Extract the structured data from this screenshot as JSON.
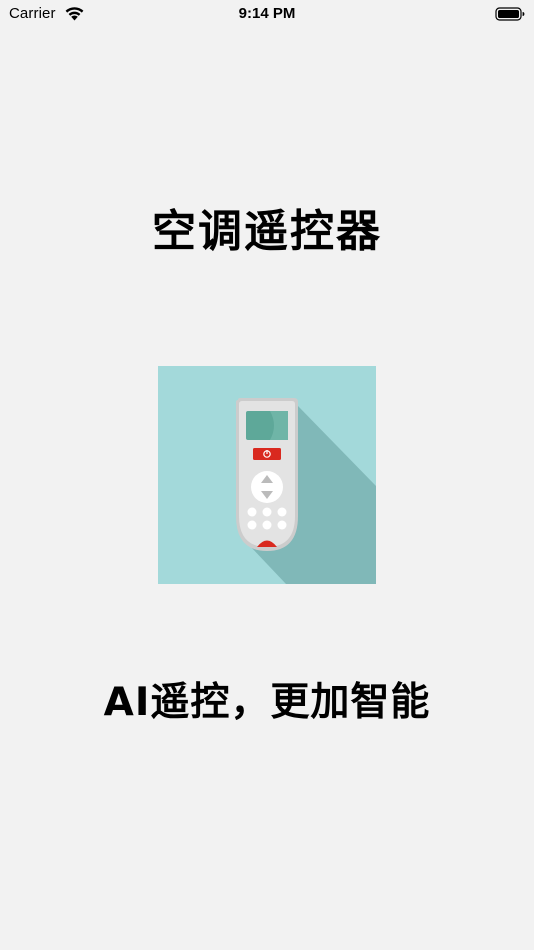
{
  "status_bar": {
    "carrier": "Carrier",
    "time": "9:14 PM",
    "icons": [
      "wifi-icon",
      "battery-icon"
    ]
  },
  "main": {
    "title": "空调遥控器",
    "illustration": "air-conditioner-remote-icon",
    "tagline": "AI遥控，更加智能"
  },
  "colors": {
    "background": "#f2f2f2",
    "illustration_bg": "#a3d9da",
    "illustration_shadow": "#80b8b8",
    "remote_body": "#e3e3e3",
    "remote_screen": "#5ea899",
    "accent_red": "#d9291f"
  }
}
